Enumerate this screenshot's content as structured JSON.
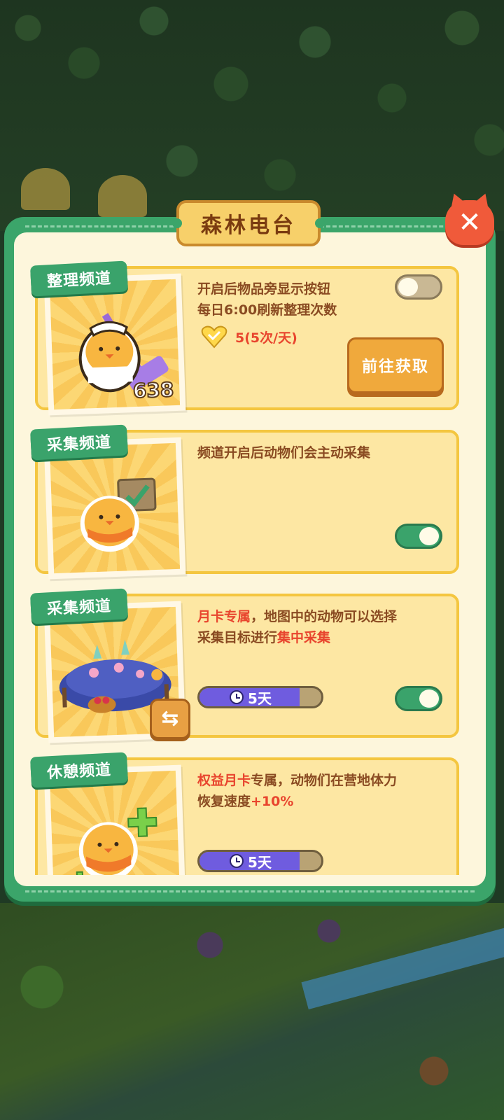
{
  "panel": {
    "title": "森林电台",
    "close_icon": "close-icon"
  },
  "channels": [
    {
      "tab": "整理频道",
      "line1": "开启后物品旁显示按钮",
      "line2": "每日6:00刷新整理次数",
      "count": "5(5次/天)",
      "badge_number": "638",
      "button": "前往获取",
      "toggle_on": false,
      "image": "maid-chick-with-mop"
    },
    {
      "tab": "采集频道",
      "line1": "频道开启后动物们会主动采集",
      "toggle_on": true,
      "image": "chick-with-checkmark-sign"
    },
    {
      "tab": "采集频道",
      "red1": "月卡专属",
      "text1": "，地图中的动物可以选择",
      "text2": "采集目标进行",
      "red2": "集中采集",
      "timer": "5天",
      "timer_fill_pct": 82,
      "toggle_on": true,
      "image": "flower-hut-with-basket"
    },
    {
      "tab": "休憩频道",
      "red1": "权益月卡",
      "text1": "专属，动物们在营地体力",
      "text2": "恢复速度",
      "red2": "+10%",
      "timer": "5天",
      "timer_fill_pct": 82,
      "image": "chick-with-plus-signs"
    }
  ],
  "colors": {
    "panel_green": "#3ba56a",
    "card_yellow": "#fde7a3",
    "text_brown": "#8a4b22",
    "accent_red": "#e8452e",
    "timer_purple": "#6f5cdf"
  }
}
